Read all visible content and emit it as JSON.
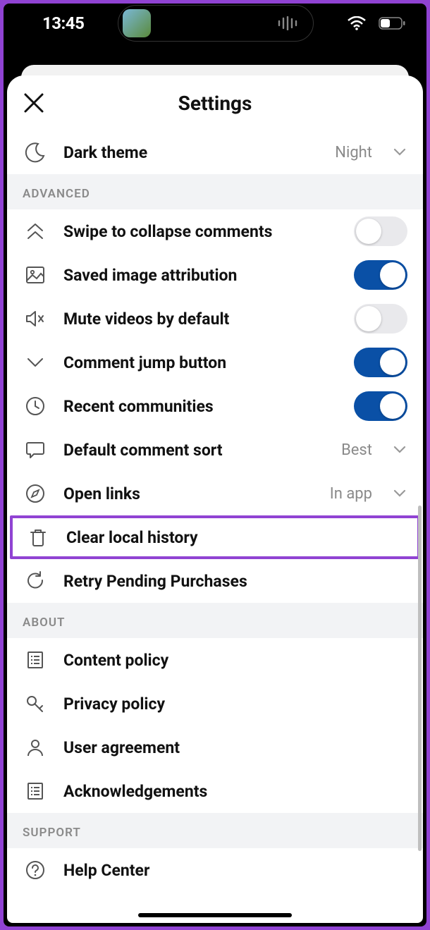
{
  "status": {
    "time": "13:45"
  },
  "header": {
    "title": "Settings"
  },
  "dark_theme": {
    "label": "Dark theme",
    "value": "Night"
  },
  "sections": {
    "advanced": "ADVANCED",
    "about": "ABOUT",
    "support": "SUPPORT"
  },
  "advanced": {
    "swipe_collapse": {
      "label": "Swipe to collapse comments",
      "on": false
    },
    "saved_attr": {
      "label": "Saved image attribution",
      "on": true
    },
    "mute_videos": {
      "label": "Mute videos by default",
      "on": false
    },
    "comment_jump": {
      "label": "Comment jump button",
      "on": true
    },
    "recent_comm": {
      "label": "Recent communities",
      "on": true
    },
    "default_sort": {
      "label": "Default comment sort",
      "value": "Best"
    },
    "open_links": {
      "label": "Open links",
      "value": "In app"
    },
    "clear_history": {
      "label": "Clear local history"
    },
    "retry_purchases": {
      "label": "Retry Pending Purchases"
    }
  },
  "about": {
    "content_policy": {
      "label": "Content policy"
    },
    "privacy_policy": {
      "label": "Privacy policy"
    },
    "user_agreement": {
      "label": "User agreement"
    },
    "ack": {
      "label": "Acknowledgements"
    }
  },
  "support": {
    "help_center": {
      "label": "Help Center"
    }
  }
}
